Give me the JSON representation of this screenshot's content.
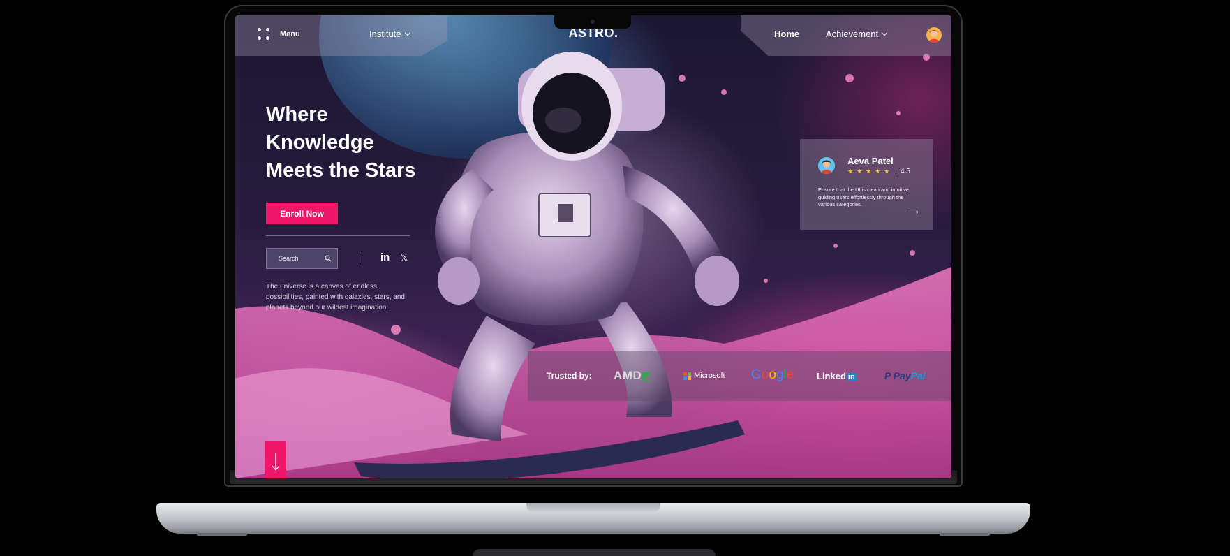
{
  "nav": {
    "menu_label": "Menu",
    "institute_label": "Institute",
    "brand": "ASTRO.",
    "home_label": "Home",
    "achievement_label": "Achievement"
  },
  "hero": {
    "title_line1": "Where",
    "title_line2": "Knowledge",
    "title_line3": "Meets the Stars",
    "cta_label": "Enroll Now",
    "search_placeholder": "Search",
    "social_linkedin": "in",
    "social_x": "𝕏",
    "description": "The universe is a canvas of endless possibilities, painted with galaxies, stars, and planets beyond our wildest imagination."
  },
  "review": {
    "name": "Aeva Patel",
    "stars": "★★★★★",
    "rating": "4.5",
    "text": "Ensure that the UI is clean and intuitive, guiding users effortlessly through the various categories.",
    "arrow": "⟶"
  },
  "trusted": {
    "label": "Trusted by:",
    "logos": {
      "amd": "AMD",
      "microsoft": "Microsoft",
      "google_G": "G",
      "google_o1": "o",
      "google_o2": "o",
      "google_g": "g",
      "google_l": "l",
      "google_e": "e",
      "linkedin": "Linked",
      "linkedin_in": "in",
      "paypal_a": "Pay",
      "paypal_b": "Pal"
    }
  },
  "colors": {
    "accent": "#f0166a",
    "star": "#f7c43a",
    "google": [
      "#4285f4",
      "#ea4335",
      "#fbbc05",
      "#4285f4",
      "#34a853",
      "#ea4335"
    ],
    "microsoft": [
      "#f25022",
      "#7fba00",
      "#00a4ef",
      "#ffb900"
    ],
    "paypal": [
      "#253b80",
      "#179bd7"
    ]
  },
  "icons": {
    "menu": "menu-grid-icon",
    "search": "search-icon",
    "scroll": "arrow-down-icon",
    "review_next": "arrow-right-icon"
  }
}
